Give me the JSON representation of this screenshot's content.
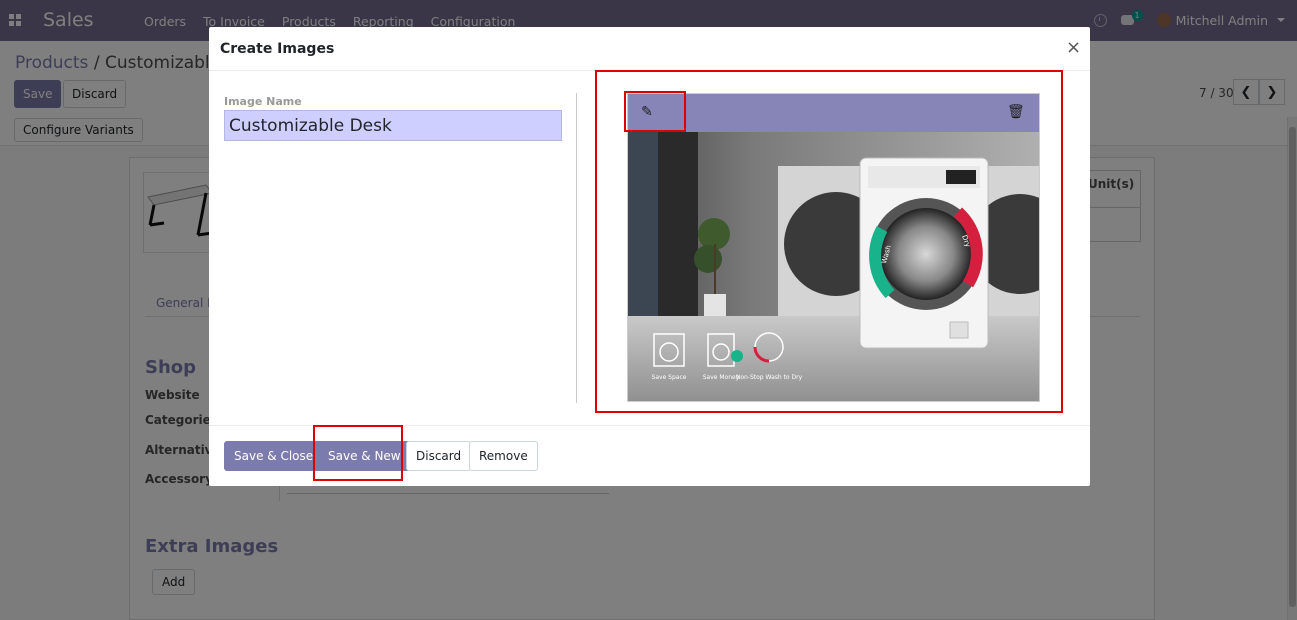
{
  "navbar": {
    "app_name": "Sales",
    "menu": [
      "Orders",
      "To Invoice",
      "Products",
      "Reporting",
      "Configuration"
    ],
    "chat_count": "1",
    "user_name": "Mitchell Admin"
  },
  "control_panel": {
    "breadcrumb_parent": "Products",
    "breadcrumb_separator": "/",
    "breadcrumb_current": "Customizable Desk",
    "save_label": "Save",
    "discard_label": "Discard",
    "pager_text": "7 / 30",
    "configure_variants_label": "Configure Variants"
  },
  "form": {
    "variants_header": "Unit(s)",
    "tab_general": "General Information",
    "shop_title": "Shop",
    "shop_fields": [
      "Website",
      "Categories",
      "Alternative Products",
      "Accessory Products"
    ],
    "extra_images_title": "Extra Images",
    "add_label": "Add"
  },
  "modal": {
    "title": "Create Images",
    "close_symbol": "×",
    "image_name_label": "Image Name",
    "image_name_value": "Customizable Desk",
    "buttons": {
      "save_close": "Save & Close",
      "save_new": "Save & New",
      "discard": "Discard",
      "remove": "Remove"
    },
    "image_features": [
      "Save Space",
      "Save Money",
      "Non-Stop Wash to Dry"
    ],
    "drum_labels": [
      "Wash",
      "Dry"
    ]
  },
  "colors": {
    "brand": "#756c8e",
    "primary": "#7c7bad",
    "highlight": "#e00000",
    "input_focus": "#cfcfff"
  }
}
